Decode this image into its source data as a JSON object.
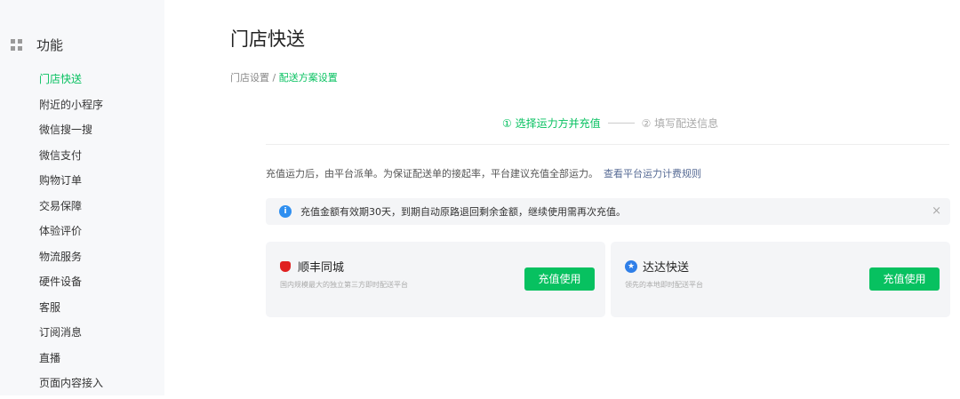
{
  "sidebar": {
    "heading": "功能",
    "items": [
      {
        "label": "门店快送",
        "active": true
      },
      {
        "label": "附近的小程序"
      },
      {
        "label": "微信搜一搜"
      },
      {
        "label": "微信支付"
      },
      {
        "label": "购物订单"
      },
      {
        "label": "交易保障"
      },
      {
        "label": "体验评价"
      },
      {
        "label": "物流服务"
      },
      {
        "label": "硬件设备"
      },
      {
        "label": "客服"
      },
      {
        "label": "订阅消息"
      },
      {
        "label": "直播"
      },
      {
        "label": "页面内容接入"
      }
    ]
  },
  "page": {
    "title": "门店快送",
    "breadcrumb": {
      "parent": "门店设置",
      "sep": " / ",
      "current": "配送方案设置"
    }
  },
  "steps": {
    "step1": "① 选择运力方并充值",
    "step2": "② 填写配送信息"
  },
  "desc": {
    "text": "充值运力后，由平台派单。为保证配送单的接起率，平台建议充值全部运力。",
    "link": "查看平台运力计费规则"
  },
  "notice": {
    "icon": "i",
    "text": "充值金额有效期30天，到期自动原路退回剩余金额，继续使用需再次充值。",
    "close": "×"
  },
  "cards": [
    {
      "name": "顺丰同城",
      "sub": "国内规模最大的独立第三方即时配送平台",
      "button": "充值使用"
    },
    {
      "name": "达达快送",
      "sub": "领先的本地即时配送平台",
      "button": "充值使用"
    }
  ],
  "colors": {
    "accent": "#07c160",
    "link": "#576b95",
    "info": "#2f8ff0"
  }
}
